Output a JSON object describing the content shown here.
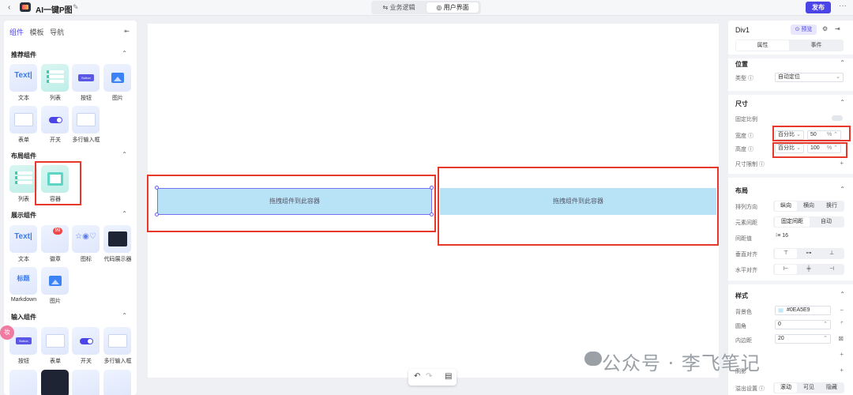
{
  "header": {
    "back_icon": "chevron-left-icon",
    "app_title": "AI一键P图",
    "edit_icon": "edit-icon",
    "tabs": [
      {
        "label": "业务逻辑",
        "icon": "share-icon",
        "active": false
      },
      {
        "label": "用户界面",
        "icon": "palette-icon",
        "active": true
      }
    ],
    "publish_label": "发布",
    "more_icon": "more-icon",
    "publish_color": "#4b45e8"
  },
  "left_panel": {
    "tabs": [
      "组件",
      "模板",
      "导航"
    ],
    "active_tab": "组件",
    "sections": [
      {
        "title": "推荐组件",
        "items": [
          {
            "label": "文本",
            "glyph": "Text|"
          },
          {
            "label": "列表"
          },
          {
            "label": "按钮",
            "glyph": "Button"
          },
          {
            "label": "图片"
          },
          {
            "label": "表单"
          },
          {
            "label": "开关"
          },
          {
            "label": "多行输入框"
          }
        ]
      },
      {
        "title": "布局组件",
        "items": [
          {
            "label": "列表"
          },
          {
            "label": "容器"
          }
        ]
      },
      {
        "title": "展示组件",
        "items": [
          {
            "label": "文本",
            "glyph": "Text|"
          },
          {
            "label": "徽章",
            "badge": "99"
          },
          {
            "label": "图标"
          },
          {
            "label": "代码展示器"
          },
          {
            "label": "Markdown",
            "glyph": "标题"
          },
          {
            "label": "图片"
          }
        ]
      },
      {
        "title": "输入组件",
        "items": [
          {
            "label": "按钮",
            "glyph": "Button"
          },
          {
            "label": "表单"
          },
          {
            "label": "开关"
          },
          {
            "label": "多行输入框"
          }
        ]
      }
    ],
    "side_tag": "妆"
  },
  "canvas": {
    "drop_text_left": "拖拽组件到此容器",
    "drop_text_right": "拖拽组件到此容器",
    "drop_color": "#b8e3f7",
    "annotation_color": "#e8382c",
    "undo_icon": "undo-icon",
    "redo_icon": "redo-icon",
    "save_icon": "file-icon"
  },
  "right_panel": {
    "title": "Div1",
    "preview_label": "预览",
    "gear_icon": "gear-icon",
    "expand_icon": "panel-icon",
    "tabs": [
      "属性",
      "事件"
    ],
    "position": {
      "section": "位置",
      "type_label": "类型",
      "type_value": "自动定位"
    },
    "size": {
      "section": "尺寸",
      "ratio_label": "固定比例",
      "width_label": "宽度",
      "width_unit": "百分比",
      "width_value": "50",
      "height_label": "高度",
      "height_unit": "百分比",
      "height_value": "100",
      "percent": "%",
      "limit_label": "尺寸限制"
    },
    "layout": {
      "section": "布局",
      "direction_label": "排列方向",
      "direction_options": [
        "纵向",
        "横向",
        "换行"
      ],
      "spacing_label": "元素间距",
      "spacing_options": [
        "固定间距",
        "自动"
      ],
      "gap_label": "间距值",
      "gap_value": "16",
      "valign_label": "垂直对齐",
      "halign_label": "水平对齐"
    },
    "style": {
      "section": "样式",
      "bg_label": "背景色",
      "bg_value": "#0EA5E9",
      "radius_label": "圆角",
      "radius_value": "0",
      "padding_label": "内边距",
      "padding_value": "20",
      "border_label": "阴影",
      "overflow_label": "溢出设置",
      "overflow_options": [
        "滚动",
        "可见",
        "隐藏"
      ]
    }
  },
  "watermark": "公众号 · 李飞笔记"
}
